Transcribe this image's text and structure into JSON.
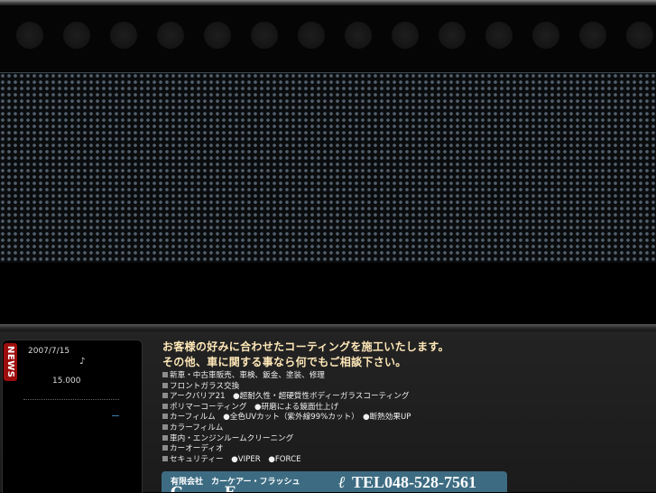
{
  "news": {
    "tab_label": "NEWS",
    "date": "2007/7/15",
    "note": "♪",
    "count": "15.000"
  },
  "headline": {
    "line1": "お客様の好みに合わせたコーティングを施工いたします。",
    "line2": "その他、車に関する事なら何でもご相談下さい。"
  },
  "services": [
    "新車・中古車販売、車検、鈑金、塗装、修理",
    "フロントガラス交換",
    "アークバリア21　●超耐久性・超硬質性ボディーガラスコーティング",
    "ポリマーコーティング　●研磨による鏡面仕上げ",
    "カーフィルム　●全色UVカット（紫外線99%カット）　●断熱効果UP",
    "カラーフィルム",
    "車内・エンジンルームクリーニング",
    "カーオーディオ",
    "セキュリティー　●VIPER　●FORCE"
  ],
  "company": {
    "name": "有限会社　カーケアー・フラッシュ",
    "logo_partial": "C  F",
    "phone": "TEL048-528-7561"
  },
  "colors": {
    "headline": "#ffe8b8",
    "news_tab": "#9e0d0d",
    "company_bar": "#3d6c82"
  },
  "icons": {
    "phone": "phone-icon",
    "bullet": "square-bullet-icon"
  }
}
